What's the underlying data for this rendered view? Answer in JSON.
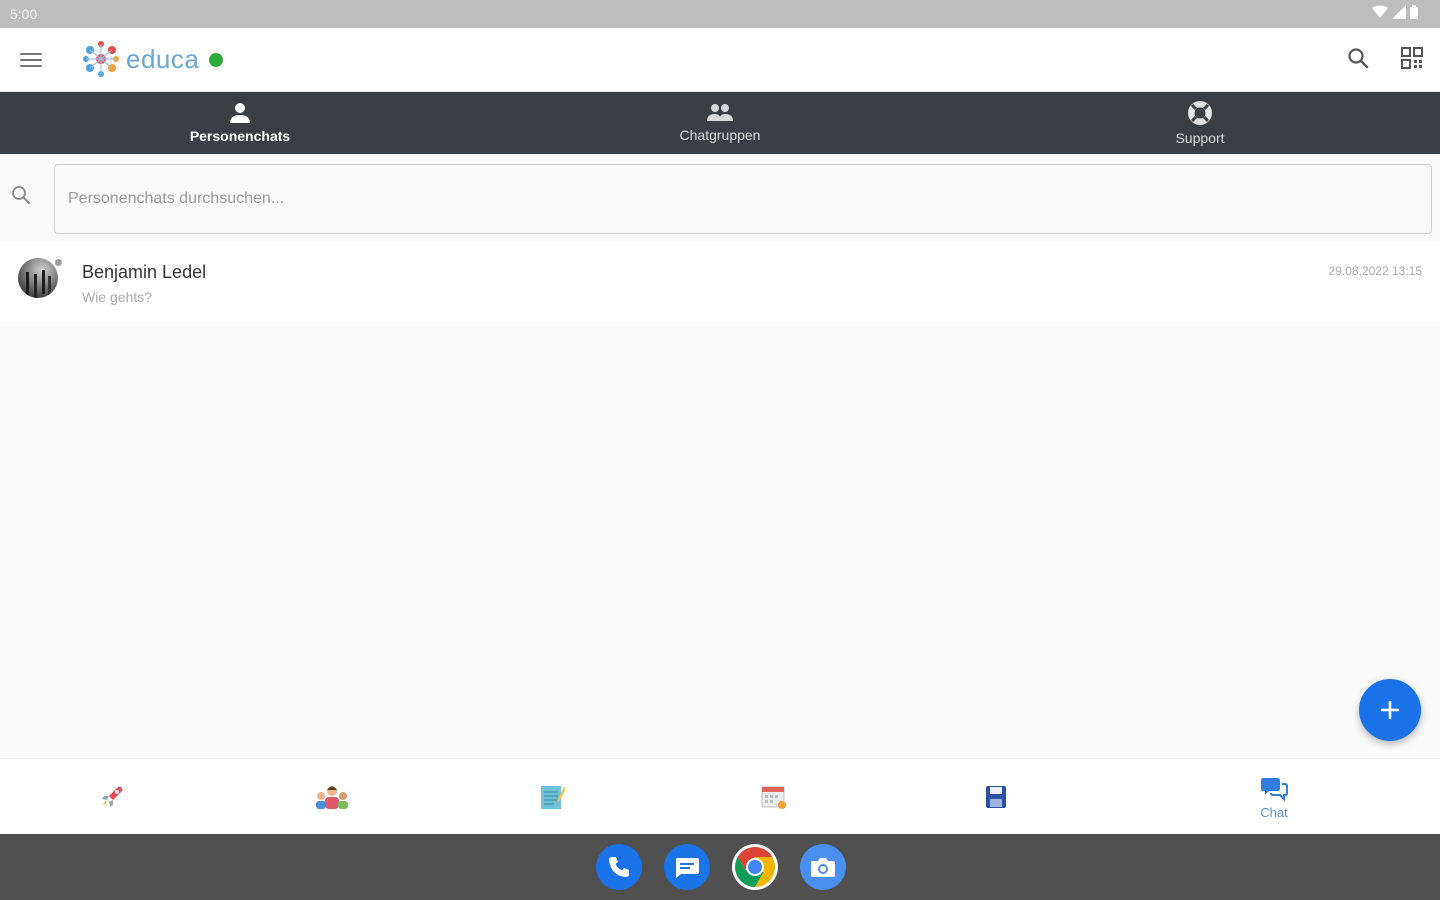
{
  "status_bar": {
    "time": "5:00"
  },
  "app_bar": {
    "logo_text": "educa",
    "icons": [
      "menu-icon",
      "search-icon",
      "qr-code-icon"
    ]
  },
  "tabs": [
    {
      "label": "Personenchats",
      "icon": "person-icon",
      "active": true
    },
    {
      "label": "Chatgruppen",
      "icon": "group-icon",
      "active": false
    },
    {
      "label": "Support",
      "icon": "support-icon",
      "active": false
    }
  ],
  "search": {
    "placeholder": "Personenchats durchsuchen..."
  },
  "chats": [
    {
      "name": "Benjamin Ledel",
      "message": "Wie gehts?",
      "timestamp": "29.08.2022 13:15"
    }
  ],
  "bottom_nav": {
    "items": [
      {
        "icon": "rocket-icon"
      },
      {
        "icon": "people-icon"
      },
      {
        "icon": "notepad-icon"
      },
      {
        "icon": "calendar-icon"
      },
      {
        "icon": "save-icon"
      },
      {
        "icon": "chat-icon",
        "label": "Chat",
        "active": true
      }
    ]
  },
  "dock": [
    "phone-icon",
    "messages-icon",
    "chrome-icon",
    "camera-icon"
  ],
  "colors": {
    "accent": "#1a73e8",
    "tabbar": "#3a3e45",
    "online": "#2eaa3b"
  }
}
